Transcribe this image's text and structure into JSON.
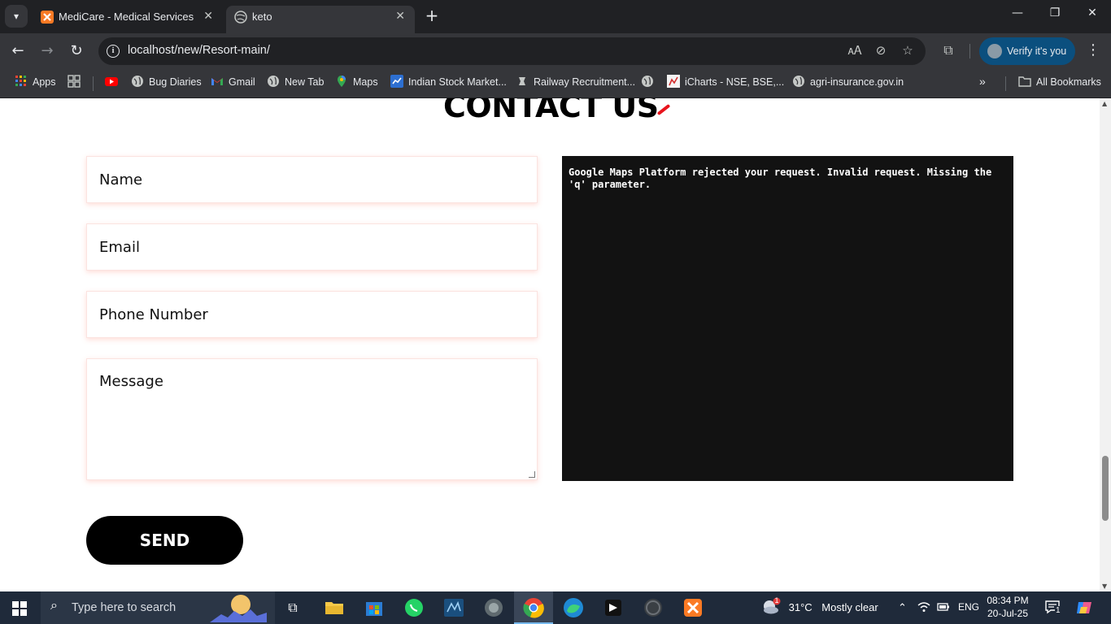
{
  "browser": {
    "tabs": [
      {
        "title": "MediCare - Medical Services",
        "favicon": "xampp-icon",
        "active": false
      },
      {
        "title": "keto",
        "favicon": "globe-icon",
        "active": true
      }
    ],
    "url": "localhost/new/Resort-main/",
    "verify_label": "Verify it's you",
    "close_glyph": "✕",
    "new_tab_glyph": "+"
  },
  "bookmarks": [
    {
      "label": "Apps",
      "icon": "apps-grid-icon"
    },
    {
      "label": "",
      "icon": "tab-groups-icon"
    },
    {
      "label": "",
      "icon": "youtube-icon"
    },
    {
      "label": "Bug Diaries",
      "icon": "globe-icon"
    },
    {
      "label": "Gmail",
      "icon": "gmail-icon"
    },
    {
      "label": "New Tab",
      "icon": "globe-icon"
    },
    {
      "label": "Maps",
      "icon": "maps-pin-icon"
    },
    {
      "label": "Indian Stock Market...",
      "icon": "stock-icon"
    },
    {
      "label": "Railway Recruitment...",
      "icon": "railway-icon"
    },
    {
      "label": "",
      "icon": "globe-icon"
    },
    {
      "label": "iCharts - NSE, BSE,...",
      "icon": "icharts-icon"
    },
    {
      "label": "agri-insurance.gov.in",
      "icon": "globe-icon"
    }
  ],
  "all_bookmarks_label": "All Bookmarks",
  "page": {
    "heading": "CONTACT US",
    "form": {
      "name_placeholder": "Name",
      "email_placeholder": "Email",
      "phone_placeholder": "Phone Number",
      "message_placeholder": "Message",
      "send_label": "SEND"
    },
    "map_error": "Google Maps Platform rejected your request. Invalid request. Missing the 'q' parameter."
  },
  "taskbar": {
    "search_placeholder": "Type here to search",
    "weather_temp": "31°C",
    "weather_text": "Mostly clear",
    "weather_badge": "1",
    "language": "ENG",
    "time": "08:34 PM",
    "date": "20-Jul-25",
    "notification_count": "1"
  },
  "colors": {
    "accent_red": "#e8141c",
    "verify_bg": "#0b4f7e",
    "map_bg": "#121212"
  }
}
